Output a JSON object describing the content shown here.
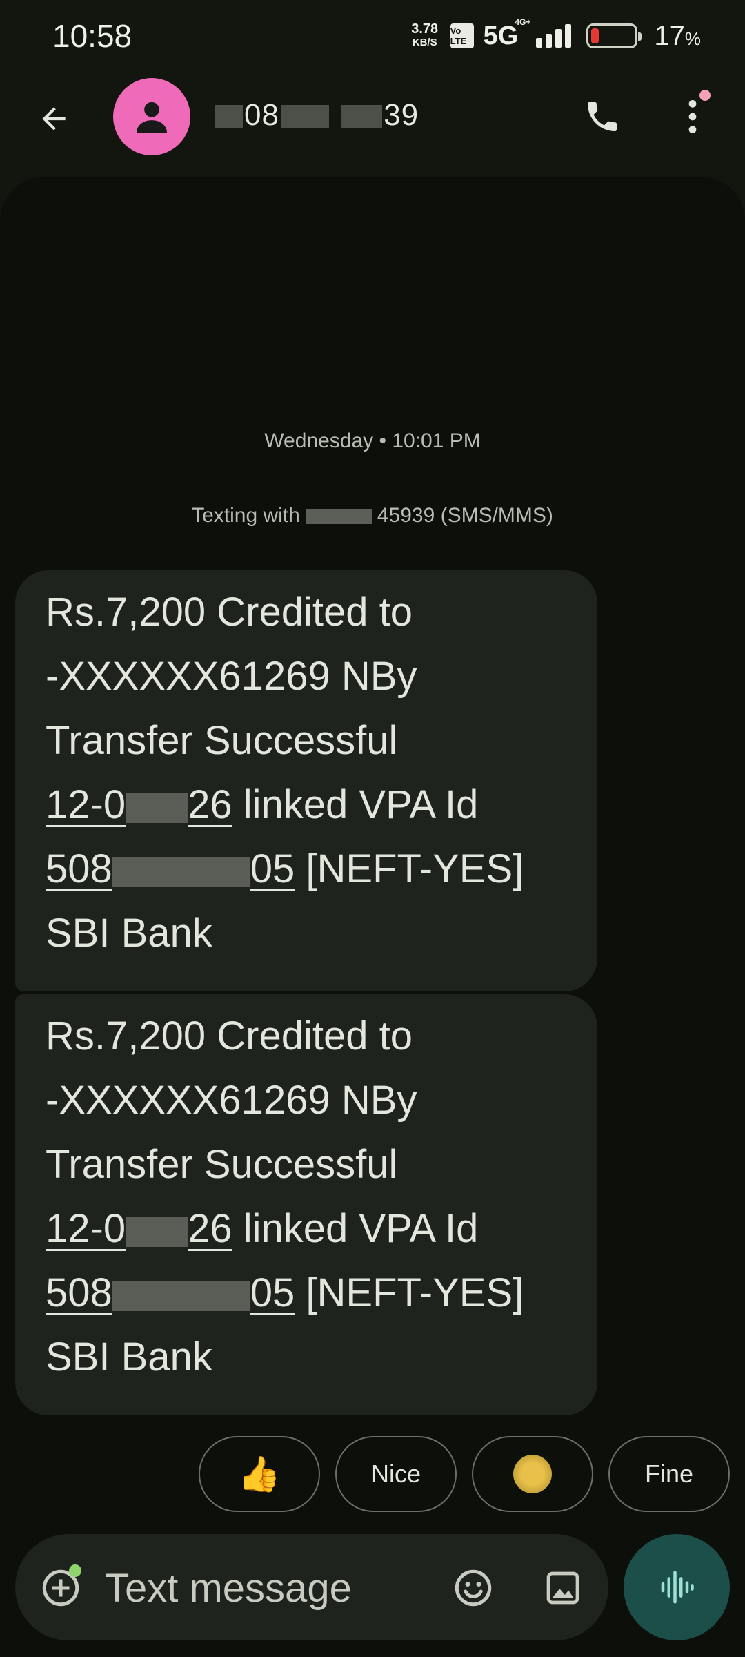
{
  "status_bar": {
    "time": "10:58",
    "net_speed_value": "3.78",
    "net_speed_unit": "KB/S",
    "volte": "Vo LTE",
    "network": "5G",
    "network_sup": "4G+",
    "battery_percent": "17",
    "battery_symbol": "%",
    "battery_level": 0.17,
    "battery_color": "#e53935"
  },
  "header": {
    "contact_prefix": "08",
    "contact_suffix": "39",
    "avatar_color": "#f06aba",
    "icons": [
      "back-arrow-icon",
      "person-icon",
      "phone-icon",
      "more-vert-icon"
    ]
  },
  "conversation": {
    "timestamp": "Wednesday • 10:01 PM",
    "texting_with_prefix": "Texting with",
    "texting_with_suffix": "45939 (SMS/MMS)",
    "messages": [
      {
        "line1": "Rs.7,200 Credited to",
        "line2": "-XXXXXX61269 NBy",
        "line3": "Transfer Successful",
        "date_start": "12-0",
        "date_end": "26",
        "line4_rest": " linked VPA Id",
        "vpa_start": "508",
        "vpa_end": "05",
        "line5_rest": " [NEFT-YES]",
        "line6": "SBI Bank"
      },
      {
        "line1": "Rs.7,200 Credited to",
        "line2": "-XXXXXX61269 NBy",
        "line3": "Transfer Successful",
        "date_start": "12-0",
        "date_end": "26",
        "line4_rest": " linked VPA Id",
        "vpa_start": "508",
        "vpa_end": "05",
        "line5_rest": " [NEFT-YES]",
        "line6": "SBI Bank"
      }
    ]
  },
  "smart_replies": [
    {
      "label": "👍"
    },
    {
      "label": "Nice"
    },
    {
      "label": ""
    },
    {
      "label": "Fine"
    }
  ],
  "composer": {
    "placeholder": "Text message",
    "accent_color": "#8fd46a",
    "voice_button_color": "#1d4f4a"
  }
}
